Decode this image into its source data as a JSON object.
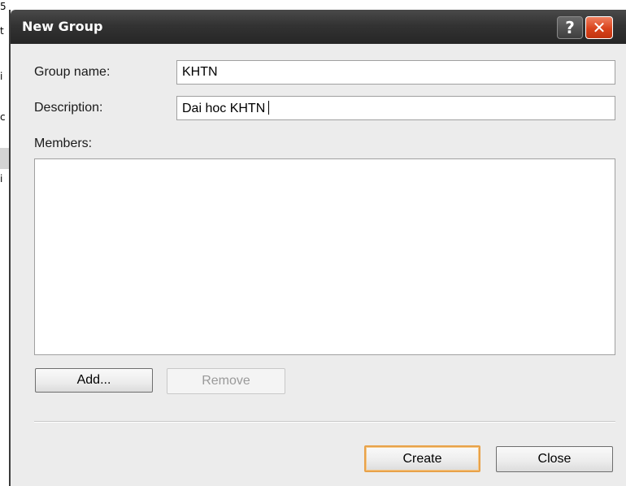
{
  "background_fragments": [
    "5",
    "t",
    "i",
    "c",
    "i"
  ],
  "dialog": {
    "title": "New Group",
    "help_glyph": "?",
    "close_glyph": "✕",
    "group_name_label": "Group name:",
    "group_name_value": "KHTN",
    "description_label": "Description:",
    "description_value": "Dai hoc KHTN",
    "members_label": "Members:",
    "members": [],
    "add_label": "Add...",
    "remove_label": "Remove",
    "create_label": "Create",
    "close_label": "Close"
  },
  "icons": {
    "help": "help-icon",
    "close": "close-icon"
  },
  "colors": {
    "titlebar": "#333333",
    "dialog_bg": "#ececec",
    "close_button": "#d9431c",
    "default_button_border": "#e8a24a"
  }
}
